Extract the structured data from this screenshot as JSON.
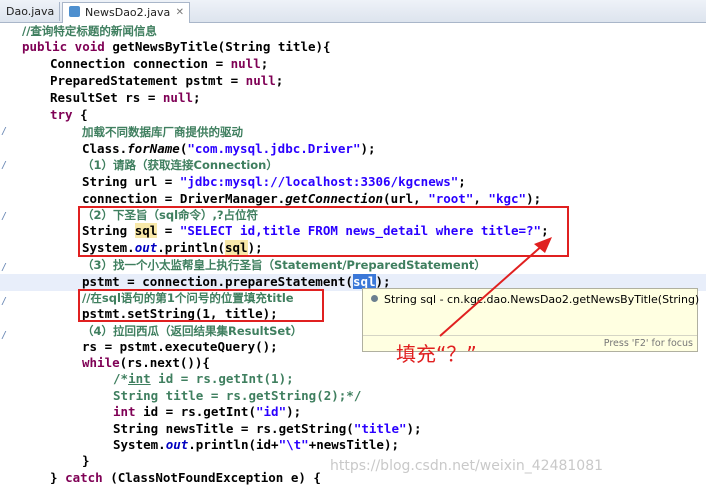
{
  "tabs": [
    {
      "label": "Dao.java"
    },
    {
      "label": "NewsDao2.java",
      "close": "✕"
    }
  ],
  "tooltip": {
    "text": "String sql - cn.kgc.dao.NewsDao2.getNewsByTitle(String)",
    "footer": "Press 'F2' for focus"
  },
  "annotation": "填充“？”",
  "watermark": "https://blog.csdn.net/weixin_42481081",
  "colors": {
    "keyword": "#7f0055",
    "string": "#2a00ff",
    "comment": "#3f7f5f",
    "annotation": "#e02020"
  },
  "code": {
    "c0": "//查询特定标题的新闻信息",
    "l1a": "public void ",
    "l1b": "getNewsByTitle(String title){",
    "l2": "Connection connection = ",
    "null": "null",
    "semi": ";",
    "l3": "PreparedStatement pstmt = ",
    "l4": "ResultSet rs = ",
    "try": "try",
    "brace_open": " {",
    "c1": "加载不同数据库厂商提供的驱动",
    "l7a": "Class.",
    "l7b": "forName",
    "l7c": "(",
    "l7s": "\"com.mysql.jdbc.Driver\"",
    "l7d": ");",
    "c2": "（1）请路（获取连接Connection）",
    "l9a": "String url = ",
    "l9s": "\"jdbc:mysql://localhost:3306/kgcnews\"",
    "l10a": "connection = DriverManager.",
    "l10b": "getConnection",
    "l10c": "(url, ",
    "l10s1": "\"root\"",
    "comma": ", ",
    "l10s2": "\"kgc\"",
    "l10d": ");",
    "c3": "（2）下圣旨（sql命令）,?占位符",
    "l12a": "String ",
    "sql": "sql",
    "l12b": " = ",
    "l12s": "\"SELECT id,title FROM news_detail where title=?\"",
    "l13a": "System.",
    "out": "out",
    "l13b": ".println(",
    "l13c": ");",
    "c4": "（3）找一个小太监帮皇上执行圣旨（Statement/PreparedStatement）",
    "l15a": "pstmt = connection.prepareStatement(",
    "l15b": ");",
    "c5": "//在sql语句的第1个问号的位置填充title",
    "l17": "pstmt.setString(1, title);",
    "c6": "（4）拉回西瓜（返回结果集ResultSet）",
    "l19": "rs = pstmt.executeQuery();",
    "while": "while",
    "l20": "(rs.next()){",
    "l21a": "/*",
    "int": "int",
    "l21b": " id = rs.getInt(1);",
    "l22": "String title = rs.getString(2);*/",
    "l23a": " id = rs.getInt(",
    "l23s": "\"id\"",
    "l23b": ");",
    "l24a": "String newsTitle = rs.getString(",
    "l24s": "\"title\"",
    "l24b": ");",
    "l25a": "System.",
    "l25b": ".println(id+",
    "l25s": "\"\\t\"",
    "l25c": "+newsTitle);",
    "close": "}",
    "l27a": "} ",
    "catch": "catch",
    "l27b": " (ClassNotFoundException e) {"
  }
}
